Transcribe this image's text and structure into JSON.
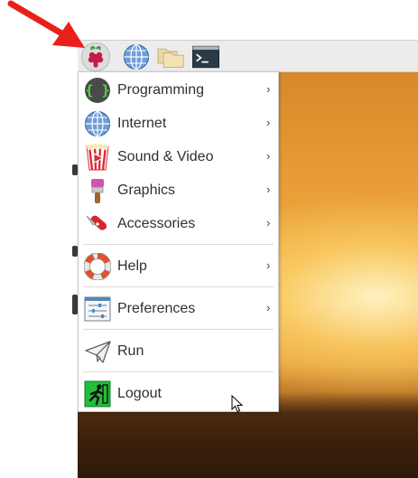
{
  "taskbar": {
    "menu_icon": "raspberry-icon",
    "launchers": [
      "globe-icon",
      "folder-icon",
      "terminal-icon"
    ]
  },
  "menu": {
    "items": [
      {
        "label": "Programming",
        "icon": "braces-icon",
        "submenu": true
      },
      {
        "label": "Internet",
        "icon": "globe-icon",
        "submenu": true
      },
      {
        "label": "Sound & Video",
        "icon": "popcorn-icon",
        "submenu": true
      },
      {
        "label": "Graphics",
        "icon": "paintbrush-icon",
        "submenu": true
      },
      {
        "label": "Accessories",
        "icon": "knife-icon",
        "submenu": true
      },
      {
        "label": "Help",
        "icon": "lifebuoy-icon",
        "submenu": true
      },
      {
        "label": "Preferences",
        "icon": "sliders-icon",
        "submenu": true
      },
      {
        "label": "Run",
        "icon": "paper-plane-icon",
        "submenu": false
      },
      {
        "label": "Logout",
        "icon": "exit-icon",
        "submenu": false
      }
    ],
    "chevron": "›"
  },
  "colors": {
    "arrow": "#e8201c",
    "taskbar": "#ececec",
    "menu_bg": "#ffffff"
  }
}
